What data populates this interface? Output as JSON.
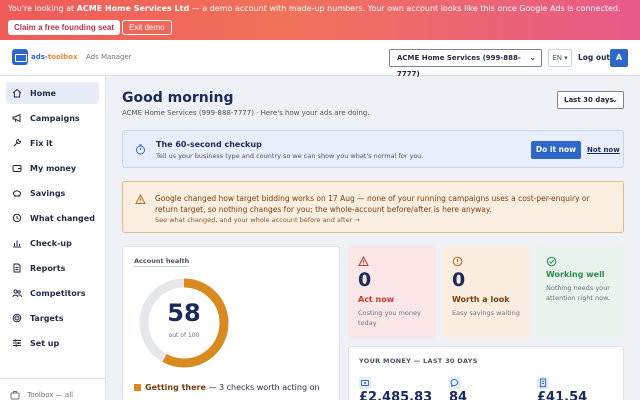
{
  "banner": {
    "text_prefix": "You're looking at ",
    "account_name": "ACME Home Services Ltd",
    "text_suffix": " — a demo account with made-up numbers. Your own account looks like this once Google Ads is connected.",
    "claim_label": "Claim a free founding seat",
    "exit_label": "Exit demo"
  },
  "header": {
    "logo_main": "ads-",
    "logo_accent": "toolbox",
    "ads_manager_label": "Ads Manager",
    "account_select": "ACME Home Services (999-888-7777)",
    "language": "EN ▾",
    "logout_label": "Log out",
    "avatar_initial": "A"
  },
  "sidebar": {
    "items": [
      {
        "label": "Home",
        "icon": "home-icon",
        "active": true
      },
      {
        "label": "Campaigns",
        "icon": "megaphone-icon"
      },
      {
        "label": "Fix it",
        "icon": "wrench-icon"
      },
      {
        "label": "My money",
        "icon": "wallet-icon"
      },
      {
        "label": "Savings",
        "icon": "piggy-bank-icon"
      },
      {
        "label": "What changed",
        "icon": "history-icon"
      },
      {
        "label": "Check-up",
        "icon": "bar-chart-icon"
      },
      {
        "label": "Reports",
        "icon": "document-icon"
      },
      {
        "label": "Competitors",
        "icon": "people-icon"
      },
      {
        "label": "Targets",
        "icon": "target-icon"
      },
      {
        "label": "Set up",
        "icon": "sliders-icon"
      }
    ],
    "toolbox_label": "Toolbox — all"
  },
  "main": {
    "greeting": "Good morning",
    "subtitle": "ACME Home Services (999-888-7777) · Here's how your ads are doing.",
    "date_range": "Last 30 days",
    "checkup": {
      "title": "The 60-second checkup",
      "description": "Tell us your business type and country so we can show you what's normal for you.",
      "do_it_label": "Do it now",
      "not_now_label": "Not now"
    },
    "notice": {
      "text": "Google changed how target bidding works on 17 Aug — none of your running campaigns uses a cost-per-enquiry or return target, so nothing changes for you; the whole-account before/after is here anyway.",
      "link": "See what changed, and your whole account before and after →"
    },
    "health": {
      "title": "Account health",
      "score": "58",
      "out_of": "out of 100",
      "score_value": 58,
      "status_label": "Getting there",
      "status_detail": " — 3 checks worth acting on"
    },
    "stats": [
      {
        "value": "0",
        "label": "Act now",
        "desc": "Costing you money today",
        "color": "#c23b2e",
        "bg": "#fbe7e7"
      },
      {
        "value": "0",
        "label": "Worth a look",
        "desc": "Easy savings waiting",
        "color": "#7a3d0c",
        "bg": "#fbeee0"
      },
      {
        "value": "",
        "label": "Working well",
        "desc": "Nothing needs your attention right now.",
        "color": "#2e8a4e",
        "bg": "#e8f4ec"
      }
    ],
    "money": {
      "title": "YOUR MONEY — LAST 30 DAYS",
      "items": [
        {
          "icon": "cash-icon",
          "value": "£2,485.83"
        },
        {
          "icon": "chat-icon",
          "value": "84"
        },
        {
          "icon": "receipt-icon",
          "value": "£41.54"
        }
      ]
    }
  },
  "colors": {
    "accent": "#2f66c9",
    "gauge_fill": "#d98a1e",
    "gauge_track": "#e5e7eb"
  }
}
